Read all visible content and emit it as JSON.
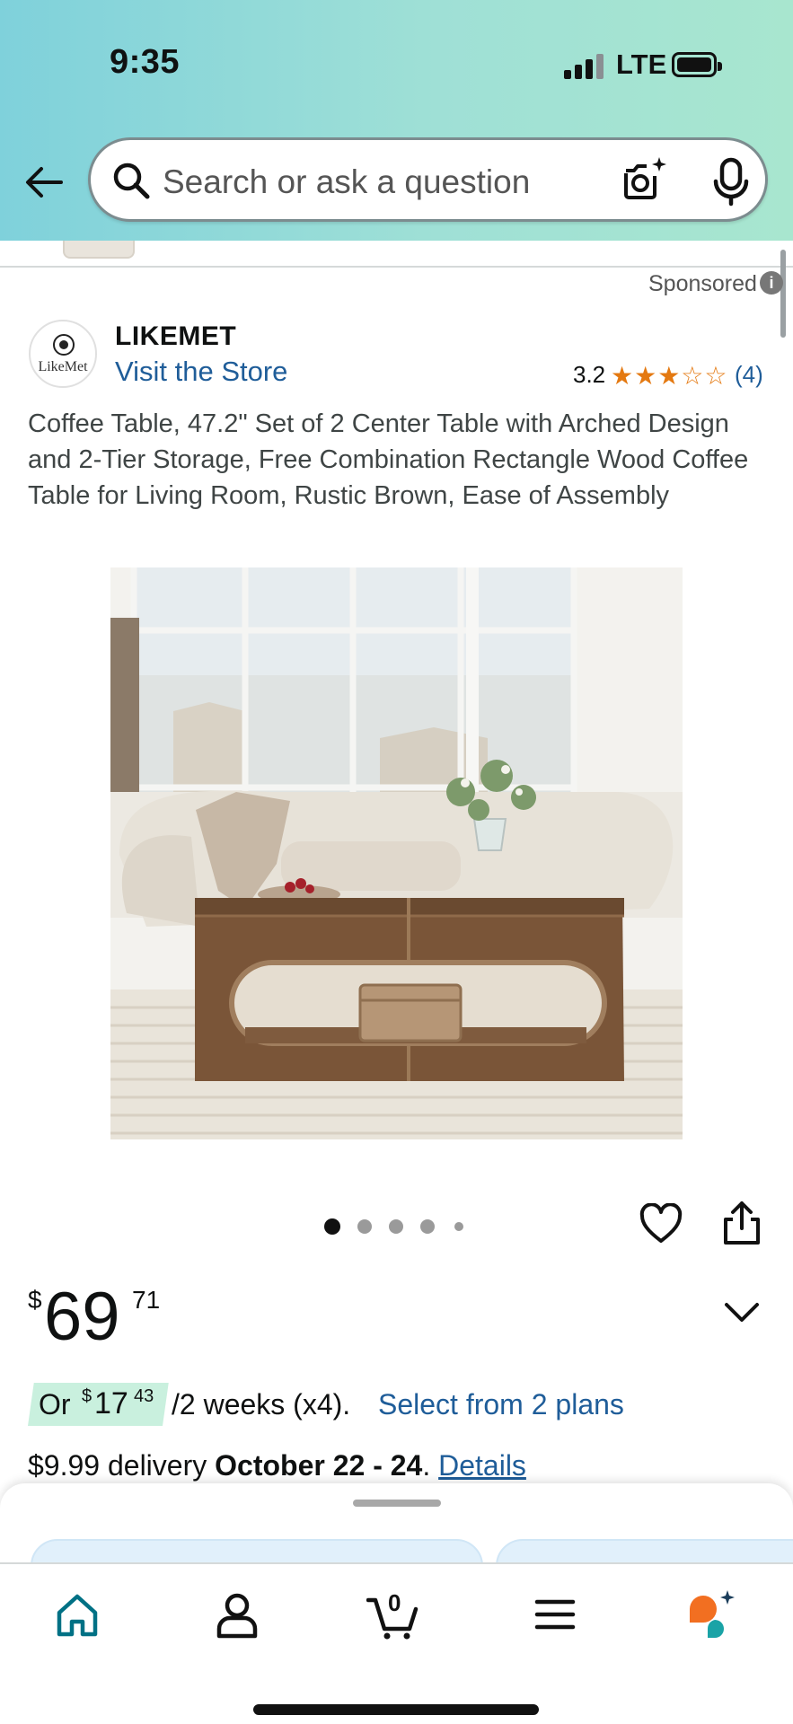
{
  "status_bar": {
    "time": "9:35",
    "network": "LTE"
  },
  "search": {
    "placeholder": "Search or ask a question"
  },
  "ad": {
    "sponsored_label": "Sponsored",
    "info_glyph": "i"
  },
  "brand": {
    "name": "LIKEMET",
    "logo_text": "LikeMet",
    "store_link": "Visit the Store"
  },
  "rating": {
    "value": "3.2",
    "stars_glyphs": "★★★☆☆",
    "stars_value": 3.2,
    "count": "(4)"
  },
  "product": {
    "title": "Coffee Table, 47.2\" Set of 2 Center Table with Arched Design and 2-Tier Storage, Free Combination Rectangle Wood Coffee Table for Living Room, Rustic Brown, Ease of Assembly",
    "image_count": 5,
    "active_image": 1
  },
  "price": {
    "currency": "$",
    "whole": "69",
    "fraction": "71"
  },
  "installment": {
    "prefix": "Or",
    "currency": "$",
    "whole": "17",
    "fraction": "43",
    "period": "/2 weeks (x4).",
    "link": "Select from 2 plans"
  },
  "delivery": {
    "fee": "$9.99 delivery",
    "dates": "October 22 - 24",
    "sep": ".",
    "details_link": "Details"
  },
  "bottom_nav": {
    "items": [
      {
        "name": "home",
        "icon": "home-icon",
        "active": true
      },
      {
        "name": "account",
        "icon": "person-icon"
      },
      {
        "name": "cart",
        "icon": "cart-icon",
        "count": "0"
      },
      {
        "name": "menu",
        "icon": "menu-icon"
      },
      {
        "name": "rufus",
        "icon": "rufus-icon"
      }
    ]
  },
  "colors": {
    "header_gradient_start": "#7fd1db",
    "header_gradient_end": "#a8e6cf",
    "link": "#1f5d99",
    "star": "#e47911",
    "active_tab": "#007185",
    "installment_badge": "#c9f0de"
  }
}
